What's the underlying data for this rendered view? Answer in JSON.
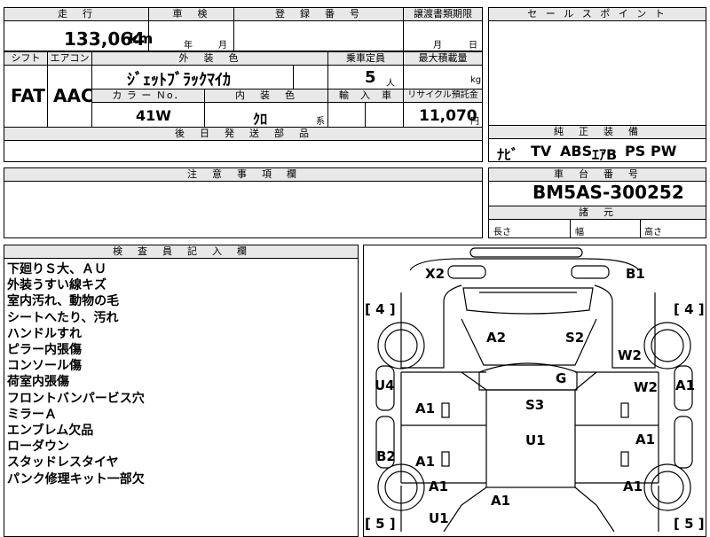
{
  "header_row": {
    "mileage_label": "走　行",
    "inspection_label": "車　検",
    "registration_label": "登　録　番　号",
    "transfer_docs_label": "譲渡書類期限",
    "mileage_value": "133,064",
    "mileage_unit": "km",
    "year_label": "年",
    "month_label": "月",
    "transfer_month": "月",
    "transfer_day": "日"
  },
  "spec": {
    "shift_label": "シフト",
    "aircon_label": "エアコン",
    "exterior_color_label": "外　装　色",
    "capacity_label": "乗車定員",
    "max_load_label": "最大積載量",
    "shift_value": "FAT",
    "aircon_value": "AAC",
    "exterior_color_value": "ｼﾞｪｯﾄﾌﾞﾗｯｸﾏｲｶ",
    "capacity_value": "5",
    "capacity_unit": "人",
    "max_load_unit": "kg",
    "color_no_label": "カ ラ ー Ｎo．",
    "interior_color_label": "内　装　色",
    "import_label": "輸　入　車",
    "recycle_label": "リサイクル預託金",
    "color_no_value": "41W",
    "interior_color_value": "ｸﾛ",
    "interior_color_suffix": "系",
    "recycle_value": "11,070",
    "recycle_unit": "円"
  },
  "later_parts_label": "後　日　発　送　部　品",
  "sales_point_label": "セ ー ル ス ポ イ ン ト",
  "equipment": {
    "label": "純　正　装　備",
    "items": [
      "ﾅﾋﾞ",
      "TV",
      "ABS",
      "ｴｱB",
      "PS",
      "PW"
    ]
  },
  "notes_label": "注　意　事　項　欄",
  "chassis": {
    "label": "車　台　番　号",
    "value": "BM5AS-300252",
    "dimensions_label": "諸　元",
    "length_label": "長さ",
    "width_label": "幅",
    "height_label": "高さ"
  },
  "inspector": {
    "label": "検　査　員　記　入　欄",
    "lines": [
      "下廻りＳ大、ＡＵ",
      "外装うすい線キズ",
      "室内汚れ、動物の毛",
      "シートへたり、汚れ",
      "ハンドルすれ",
      "ピラー内張傷",
      "コンソール傷",
      "荷室内張傷",
      "フロントバンパービス穴",
      "ミラーＡ",
      "エンブレム欠品",
      "ローダウン",
      "スタッドレスタイヤ",
      "パンク修理キット一部欠"
    ]
  },
  "damage_map": {
    "tire_top_left": "[ 4 ]",
    "tire_top_right": "[ 4 ]",
    "tire_bottom_left": "[ 5 ]",
    "tire_bottom_right": "[ 5 ]",
    "codes": {
      "x2": "X2",
      "b1": "B1",
      "a2": "A2",
      "s2": "S2",
      "w2_upper": "W2",
      "u4": "U4",
      "g": "G",
      "w2_right": "W2",
      "a1_right_upper": "A1",
      "a1_left_upper": "A1",
      "s3": "S3",
      "u1_center": "U1",
      "a1_right_mid": "A1",
      "b2": "B2",
      "a1_left_mid": "A1",
      "a1_left_lower": "A1",
      "a1_right_lower": "A1",
      "u1_bottom": "U1",
      "a1_bottom": "A1"
    }
  }
}
